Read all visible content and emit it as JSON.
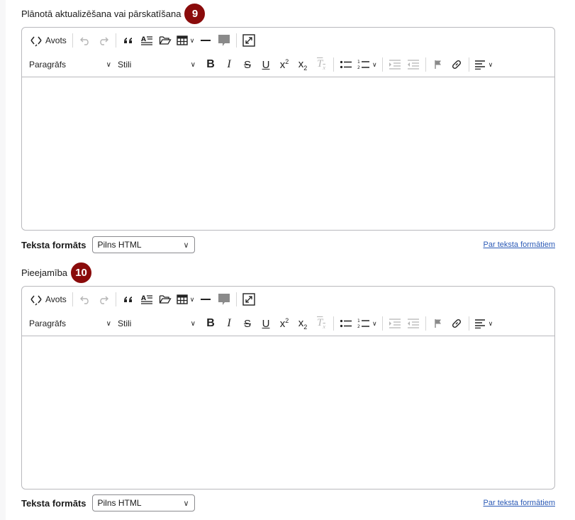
{
  "fields": [
    {
      "label": "Plānotā aktualizēšana vai pārskatīšana",
      "badge": "9",
      "toolbar": {
        "source_label": "Avots",
        "paragraph_label": "Paragrāfs",
        "styles_label": "Stili"
      },
      "format_label": "Teksta formāts",
      "format_value": "Pilns HTML",
      "format_help": "Par teksta formātiem"
    },
    {
      "label": "Pieejamība",
      "badge": "10",
      "toolbar": {
        "source_label": "Avots",
        "paragraph_label": "Paragrāfs",
        "styles_label": "Stili"
      },
      "format_label": "Teksta formāts",
      "format_value": "Pilns HTML",
      "format_help": "Par teksta formātiem"
    }
  ],
  "colors": {
    "badge": "#8a0b0b",
    "link": "#2b5ab6",
    "border": "#b9b9bd"
  },
  "icons": [
    "source-icon",
    "undo-icon",
    "redo-icon",
    "blockquote-icon",
    "abbreviation-icon",
    "media-library-icon",
    "table-icon",
    "horizontal-line-icon",
    "comment-icon",
    "fullscreen-icon",
    "bold-icon",
    "italic-icon",
    "strikethrough-icon",
    "underline-icon",
    "superscript-icon",
    "subscript-icon",
    "remove-format-icon",
    "bulleted-list-icon",
    "numbered-list-icon",
    "indent-icon",
    "outdent-icon",
    "flag-icon",
    "link-icon",
    "align-icon"
  ]
}
